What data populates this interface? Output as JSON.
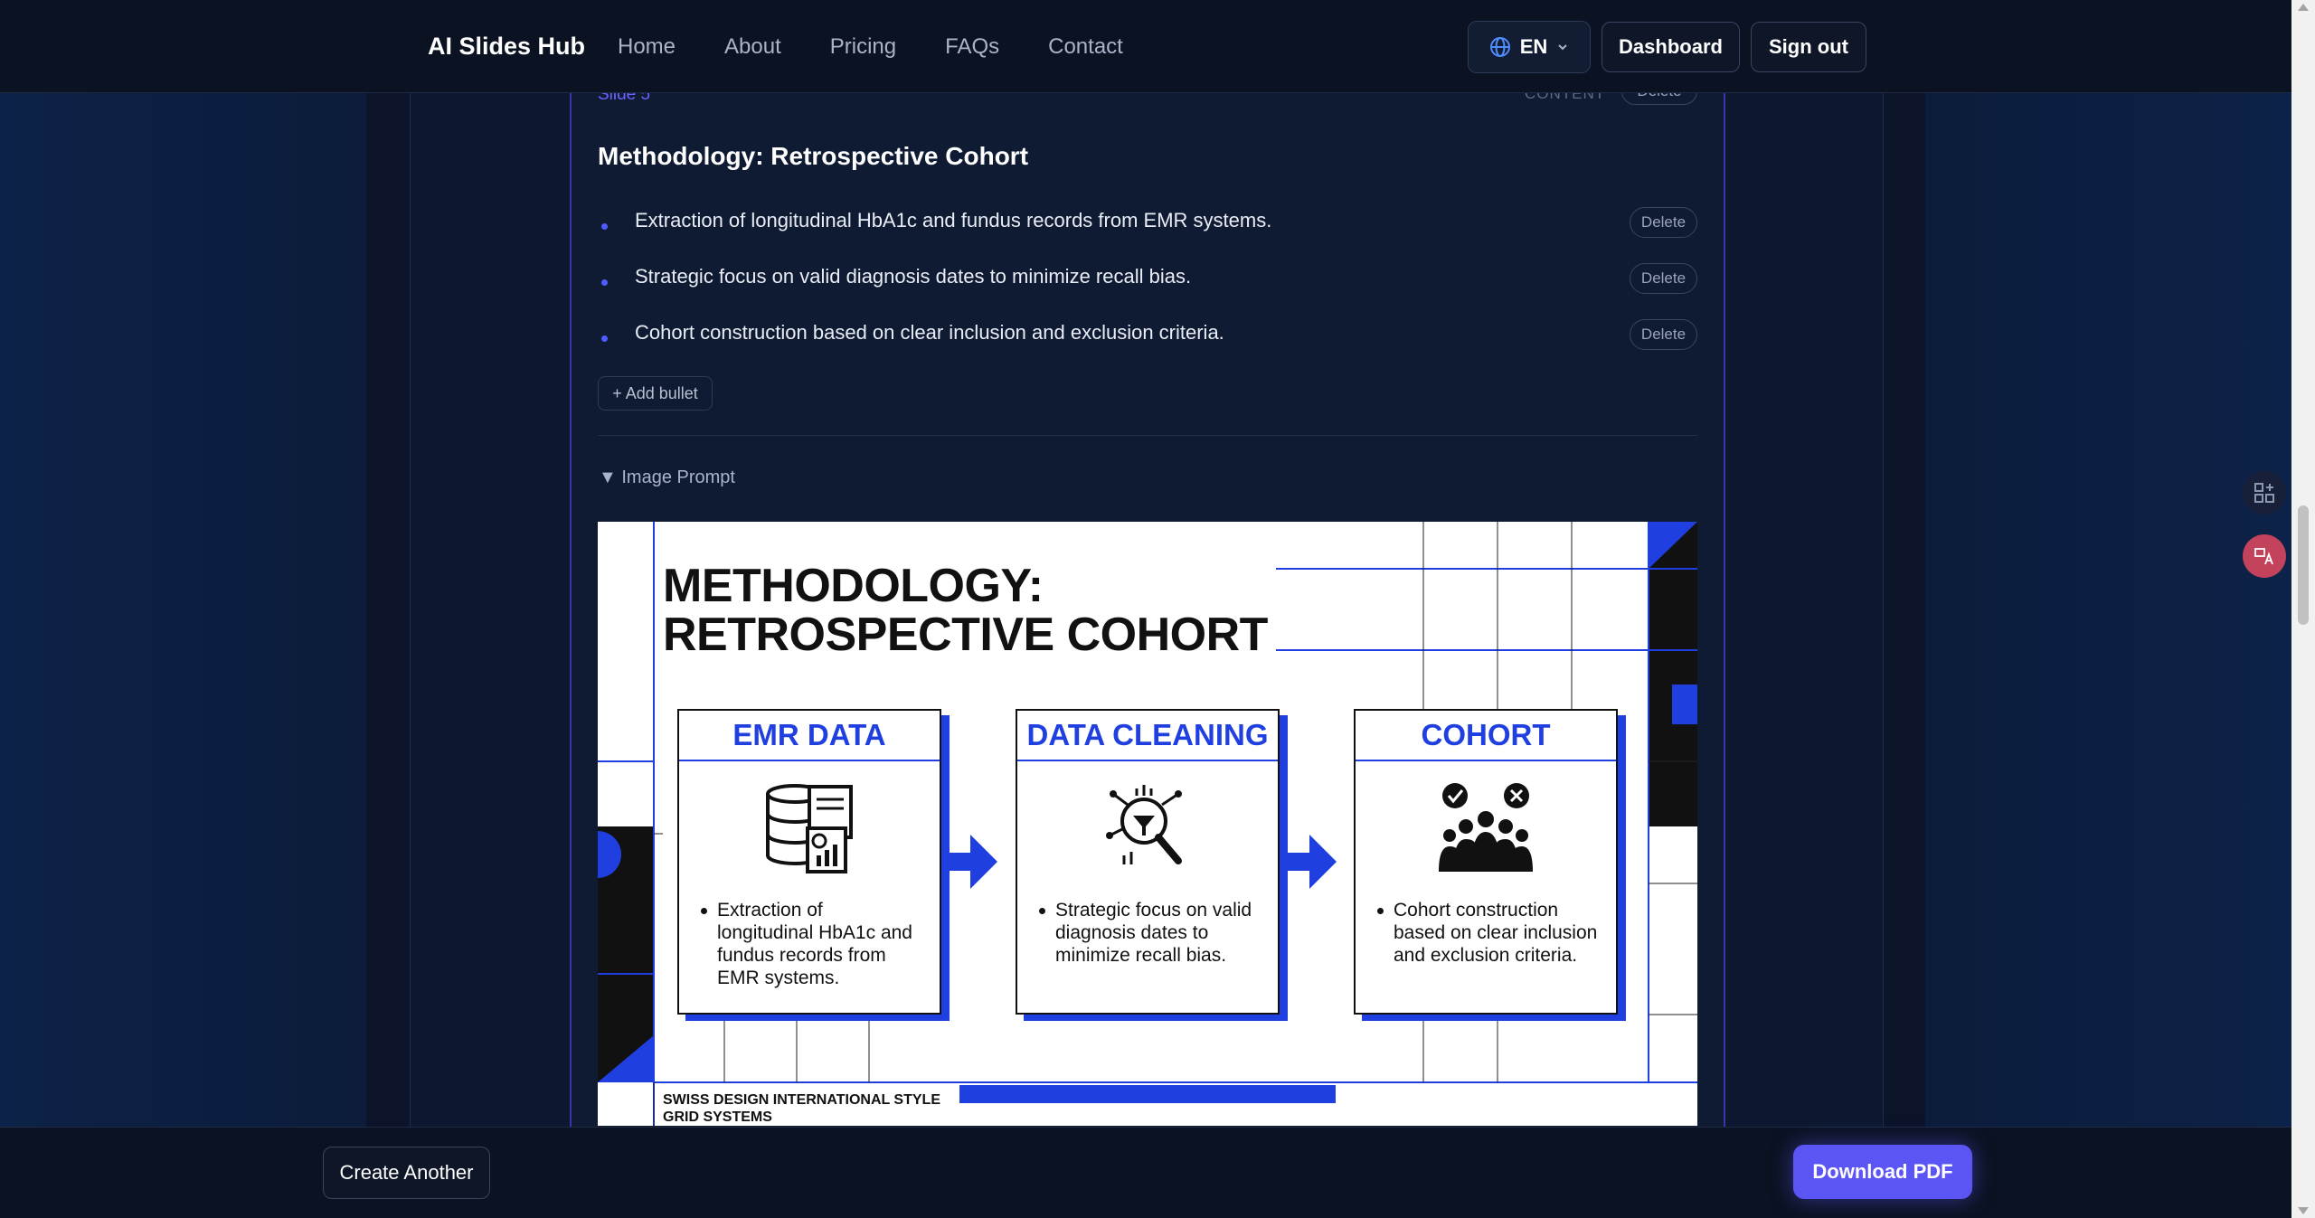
{
  "header": {
    "logo": "AI Slides Hub",
    "nav": [
      "Home",
      "About",
      "Pricing",
      "FAQs",
      "Contact"
    ],
    "language": "EN",
    "dashboard_label": "Dashboard",
    "signout_label": "Sign out"
  },
  "slide": {
    "label": "Slide 5",
    "type_label": "CONTENT",
    "delete_label": "Delete",
    "title": "Methodology: Retrospective Cohort",
    "bullets": [
      "Extraction of longitudinal HbA1c and fundus records from EMR systems.",
      "Strategic focus on valid diagnosis dates to minimize recall bias.",
      "Cohort construction based on clear inclusion and exclusion criteria."
    ],
    "bullet_delete_label": "Delete",
    "add_bullet_label": "+ Add bullet",
    "image_prompt_label": "▼ Image Prompt"
  },
  "slide_image": {
    "title_line1": "METHODOLOGY:",
    "title_line2": "RETROSPECTIVE COHORT",
    "boxes": [
      {
        "heading": "EMR DATA",
        "icon": "database-document-icon",
        "text": "Extraction of longitudinal HbA1c and fundus records from EMR systems."
      },
      {
        "heading": "DATA CLEANING",
        "icon": "filter-magnifier-icon",
        "text": "Strategic focus on valid diagnosis dates to minimize recall bias."
      },
      {
        "heading": "COHORT",
        "icon": "group-people-icon",
        "text": "Cohort construction based on clear inclusion and exclusion criteria."
      }
    ],
    "footer_line1": "SWISS DESIGN INTERNATIONAL STYLE",
    "footer_line2": "GRID SYSTEMS",
    "accent_color": "#1f3fe0"
  },
  "footer": {
    "create_label": "Create Another",
    "download_label": "Download PDF"
  },
  "colors": {
    "primary": "#5b55f5",
    "background": "#0a1428"
  }
}
